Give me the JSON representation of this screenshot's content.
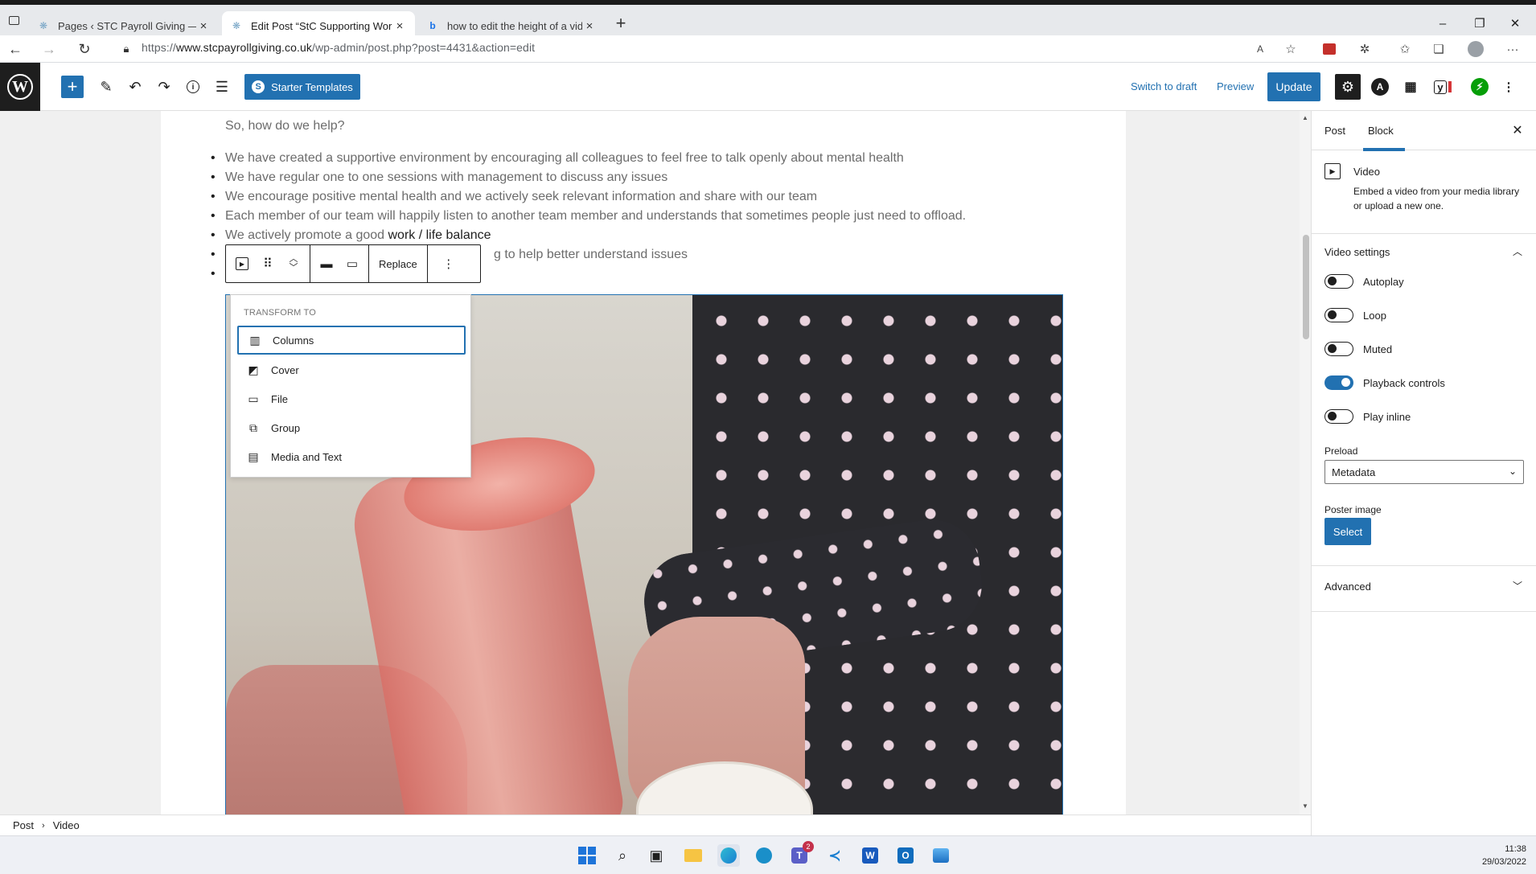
{
  "browser": {
    "tabs": [
      {
        "title": "Pages ‹ STC Payroll Giving — Wo",
        "active": false
      },
      {
        "title": "Edit Post “StC Supporting Workp",
        "active": true
      },
      {
        "title": "how to edit the height of a video",
        "active": false
      }
    ],
    "url_prefix": "https://",
    "url_domain": "www.stcpayrollgiving.co.uk",
    "url_path": "/wp-admin/post.php?post=4431&action=edit"
  },
  "toolbar": {
    "starter_templates": "Starter Templates",
    "switch_to_draft": "Switch to draft",
    "preview": "Preview",
    "update": "Update"
  },
  "content": {
    "intro": "So, how do we help?",
    "bullets": [
      "We have created a supportive environment by encouraging all colleagues to feel free to talk openly about mental health",
      "We have regular one to one sessions with management to discuss any issues",
      "We encourage positive mental health and we actively seek relevant information and share with our team",
      "Each member of our team will happily listen to another team member and understands that sometimes people just need to offload."
    ],
    "bullet5_text": "We actively promote a good ",
    "bullet5_strong": "work / life balance",
    "bullet6_partial": "g to help better understand issues"
  },
  "block_toolbar": {
    "replace": "Replace"
  },
  "transform": {
    "heading": "TRANSFORM TO",
    "items": [
      {
        "label": "Columns",
        "icon": "columns-icon"
      },
      {
        "label": "Cover",
        "icon": "cover-icon"
      },
      {
        "label": "File",
        "icon": "file-icon"
      },
      {
        "label": "Group",
        "icon": "group-icon"
      },
      {
        "label": "Media and Text",
        "icon": "media-text-icon"
      }
    ]
  },
  "breadcrumb": {
    "root": "Post",
    "current": "Video"
  },
  "sidebar": {
    "tab_post": "Post",
    "tab_block": "Block",
    "block_title": "Video",
    "block_desc": "Embed a video from your media library or upload a new one.",
    "video_settings": "Video settings",
    "toggles": [
      {
        "label": "Autoplay",
        "on": false
      },
      {
        "label": "Loop",
        "on": false
      },
      {
        "label": "Muted",
        "on": false
      },
      {
        "label": "Playback controls",
        "on": true
      },
      {
        "label": "Play inline",
        "on": false
      }
    ],
    "preload_label": "Preload",
    "preload_value": "Metadata",
    "poster_label": "Poster image",
    "poster_button": "Select",
    "advanced": "Advanced"
  },
  "taskbar": {
    "time": "11:38",
    "date": "29/03/2022",
    "teams_badge": "2"
  },
  "colors": {
    "wp_blue": "#2271b1",
    "dark": "#1e1e1e"
  }
}
